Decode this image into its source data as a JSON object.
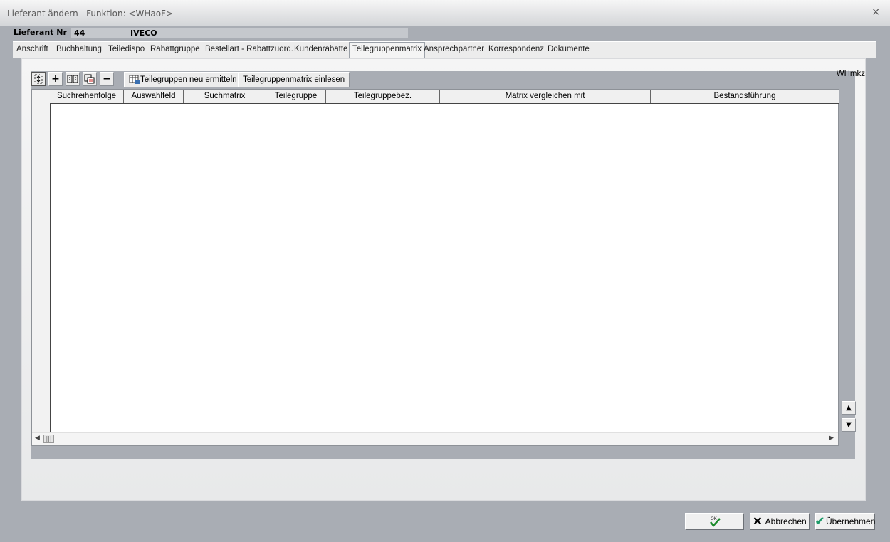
{
  "window": {
    "title": "Lieferant ändern",
    "function_label": "Funktion: <WHaoF>",
    "close_glyph": "×"
  },
  "header": {
    "label": "Lieferant Nr",
    "number": "44",
    "name": "IVECO"
  },
  "tabs": [
    {
      "label": "Anschrift"
    },
    {
      "label": "Buchhaltung"
    },
    {
      "label": "Teiledispo"
    },
    {
      "label": "Rabattgruppe"
    },
    {
      "label": "Bestellart - Rabattzuord."
    },
    {
      "label": "Kundenrabatte"
    },
    {
      "label": "Teilegruppenmatrix",
      "active": true
    },
    {
      "label": "Ansprechpartner"
    },
    {
      "label": "Korrespondenz"
    },
    {
      "label": "Dokumente"
    }
  ],
  "toolbar": {
    "refresh_icon": "refresh-icon",
    "add_icon": "+",
    "remove_icon": "−",
    "btn_ermitteln": "Teilegruppen neu ermitteln",
    "btn_einlesen": "Teilegruppenmatrix einlesen",
    "whmkz": "WHmkz"
  },
  "table": {
    "columns": [
      "Suchreihenfolge",
      "Auswahlfeld",
      "Suchmatrix",
      "Teilegruppe",
      "Teilegruppebez.",
      "Matrix vergleichen mit",
      "Bestandsführung"
    ],
    "rows": []
  },
  "footer": {
    "ok_label": "OK",
    "cancel_label": "Abbrechen",
    "apply_label": "Übernehmen"
  }
}
